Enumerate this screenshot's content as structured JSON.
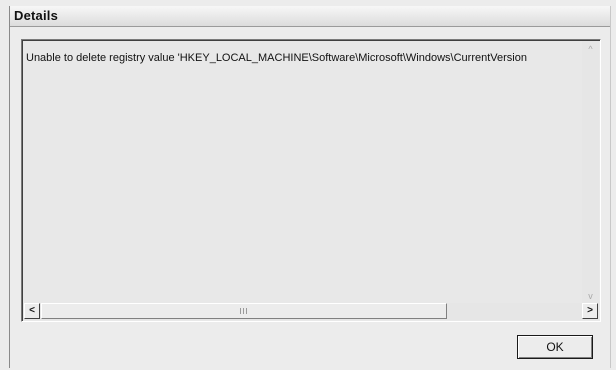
{
  "window": {
    "title": "Details"
  },
  "details": {
    "text": "Unable to delete registry value 'HKEY_LOCAL_MACHINE\\Software\\Microsoft\\Windows\\CurrentVersion"
  },
  "scrollbars": {
    "up_icon": "up-arrow",
    "down_icon": "down-arrow",
    "left_icon": "left-arrow",
    "right_icon": "right-arrow",
    "left_glyph": "<",
    "right_glyph": ">",
    "up_glyph": "^",
    "down_glyph": "v"
  },
  "buttons": {
    "ok_label": "OK"
  }
}
